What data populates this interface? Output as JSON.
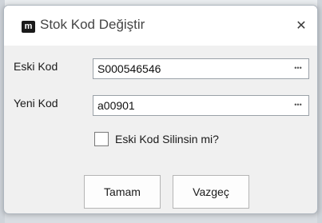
{
  "dialog": {
    "logo_text": "m",
    "title": "Stok Kod Değiştir",
    "close_glyph": "✕"
  },
  "fields": {
    "old_code": {
      "label": "Eski Kod",
      "value": "S000546546",
      "button": "•••"
    },
    "new_code": {
      "label": "Yeni Kod",
      "value": "a00901",
      "button": "•••"
    }
  },
  "checkbox": {
    "label": "Eski Kod Silinsin mi?",
    "checked": false
  },
  "buttons": {
    "ok": "Tamam",
    "cancel": "Vazgeç"
  },
  "icons": {
    "logo": "app-logo-icon",
    "close": "close-icon",
    "ellipsis": "ellipsis-icon"
  },
  "colors": {
    "dialog_bg": "#f0f0f0",
    "titlebar_bg": "#ffffff",
    "field_border": "#9aa1a8"
  }
}
